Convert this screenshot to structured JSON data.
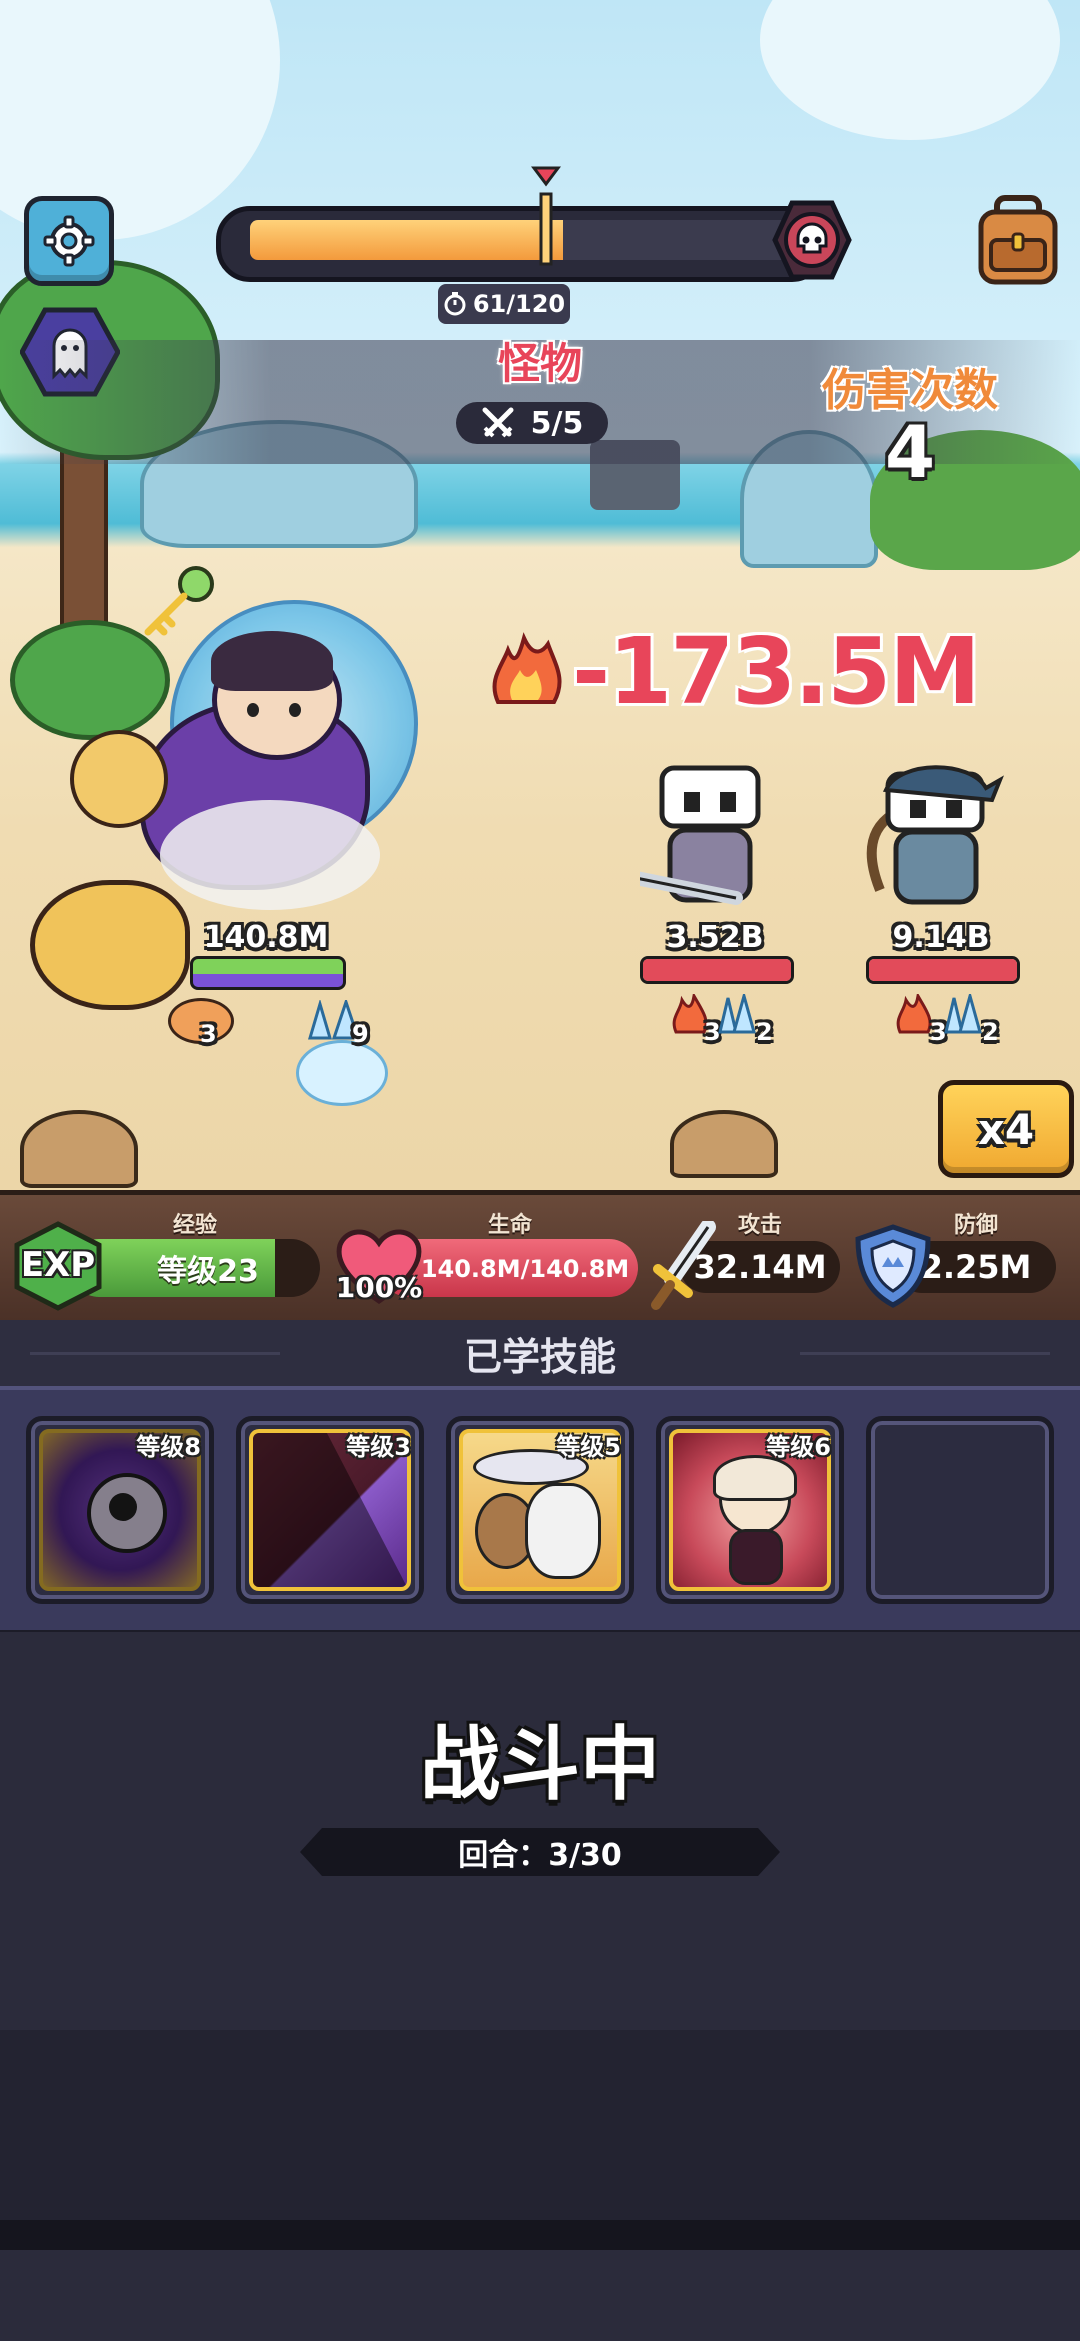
{
  "top_hud": {
    "timer": "61/120",
    "stage_title": "怪物",
    "wave": "5/5",
    "hit_count_label": "伤害次数",
    "hit_count_value": "4",
    "damage_popup": "-173.5M",
    "boss_progress": 0.58
  },
  "battle": {
    "hero_hp": "140.8M",
    "hero_summon_count_a": "3",
    "hero_summon_count_b": "9",
    "enemies": [
      {
        "hp": "3.52B",
        "burn": "3",
        "freeze": "2"
      },
      {
        "hp": "9.14B",
        "burn": "3",
        "freeze": "2"
      }
    ],
    "speed_button": "x4"
  },
  "stats": {
    "exp_badge": "EXP",
    "exp_label": "经验",
    "level_text": "等级23",
    "hp_label": "生命",
    "hp_percent": "100%",
    "hp_value": "140.8M/140.8M",
    "atk_label": "攻击",
    "atk_value": "32.14M",
    "def_label": "防御",
    "def_value": "2.25M"
  },
  "skills": {
    "header": "已学技能",
    "items": [
      {
        "level": "等级8",
        "state": "cooldown"
      },
      {
        "level": "等级3",
        "state": "cooldown"
      },
      {
        "level": "等级5",
        "state": "ready"
      },
      {
        "level": "等级6",
        "state": "ready"
      }
    ]
  },
  "status": {
    "title": "战斗中",
    "round": "回合：3/30"
  },
  "colors": {
    "gold": "#f0c23a",
    "damage_red": "#e8455a",
    "panel": "#3a3a5c"
  }
}
